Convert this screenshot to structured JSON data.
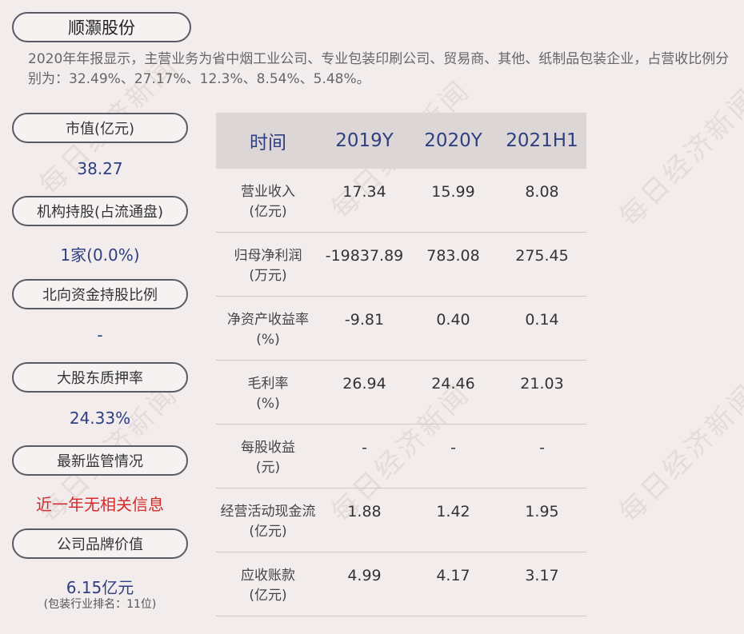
{
  "company": "顺灏股份",
  "description": "2020年年报显示，主营业务为省中烟工业公司、专业包装印刷公司、贸易商、其他、纸制品包装企业，占营收比例分别为：32.49%、27.17%、12.3%、8.54%、5.48%。",
  "left": [
    {
      "label": "市值(亿元)",
      "value": "38.27"
    },
    {
      "label": "机构持股(占流通盘)",
      "value": "1家(0.0%)"
    },
    {
      "label": "北向资金持股比例",
      "value": "-"
    },
    {
      "label": "大股东质押率",
      "value": "24.33%"
    },
    {
      "label": "最新监管情况",
      "value": "近一年无相关信息"
    },
    {
      "label": "公司品牌价值",
      "value": "6.15亿元",
      "note": "(包装行业排名：11位)"
    }
  ],
  "table": {
    "header": [
      "时间",
      "2019Y",
      "2020Y",
      "2021H1"
    ],
    "rows": [
      {
        "label": [
          "营业收入",
          "(亿元)"
        ],
        "values": [
          "17.34",
          "15.99",
          "8.08"
        ]
      },
      {
        "label": [
          "归母净利润",
          "(万元)"
        ],
        "values": [
          "-19837.89",
          "783.08",
          "275.45"
        ]
      },
      {
        "label": [
          "净资产收益率",
          "(%)"
        ],
        "values": [
          "-9.81",
          "0.40",
          "0.14"
        ]
      },
      {
        "label": [
          "毛利率",
          "(%)"
        ],
        "values": [
          "26.94",
          "24.46",
          "21.03"
        ]
      },
      {
        "label": [
          "每股收益",
          "(元)"
        ],
        "values": [
          "-",
          "-",
          "-"
        ]
      },
      {
        "label": [
          "经营活动现金流",
          "(亿元)"
        ],
        "values": [
          "1.88",
          "1.42",
          "1.95"
        ]
      },
      {
        "label": [
          "应收账款",
          "(亿元)"
        ],
        "values": [
          "4.99",
          "4.17",
          "3.17"
        ]
      }
    ]
  },
  "watermark": "每日经济新闻"
}
